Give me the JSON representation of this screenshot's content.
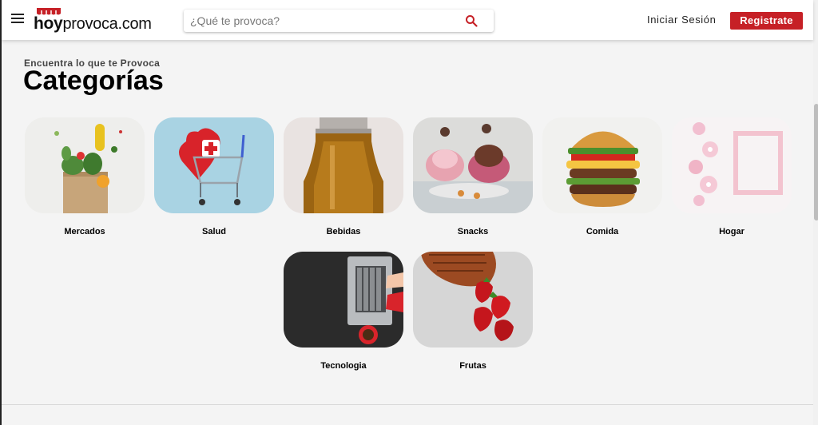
{
  "header": {
    "logo_bold": "hoy",
    "logo_rest": "provoca.com",
    "search_placeholder": "¿Qué te provoca?",
    "login_label": "Iniciar Sesión",
    "register_label": "Registrate"
  },
  "main": {
    "subtitle": "Encuentra lo que te Provoca",
    "title": "Categorías",
    "categories": [
      {
        "label": "Mercados"
      },
      {
        "label": "Salud"
      },
      {
        "label": "Bebidas"
      },
      {
        "label": "Snacks"
      },
      {
        "label": "Comida"
      },
      {
        "label": "Hogar"
      },
      {
        "label": "Tecnologia"
      },
      {
        "label": "Frutas"
      }
    ]
  },
  "colors": {
    "accent": "#c62026",
    "background": "#f4f4f4"
  }
}
